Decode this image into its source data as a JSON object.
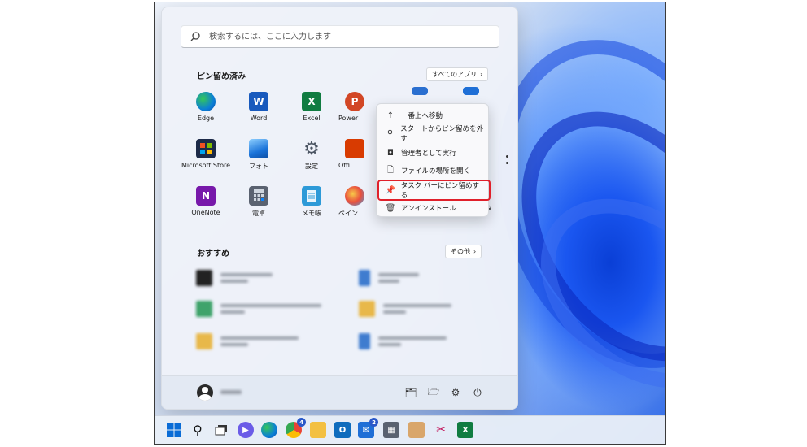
{
  "search": {
    "placeholder": "検索するには、ここに入力します"
  },
  "pinned": {
    "title": "ピン留め済み",
    "all_apps_label": "すべてのアプリ",
    "apps": [
      {
        "label": "Edge"
      },
      {
        "label": "Word"
      },
      {
        "label": "Excel"
      },
      {
        "label": "Power"
      },
      {
        "label": "Microsoft Store"
      },
      {
        "label": "フォト"
      },
      {
        "label": "設定"
      },
      {
        "label": "Offi"
      },
      {
        "label": "ook"
      },
      {
        "label": "OneNote"
      },
      {
        "label": "電卓"
      },
      {
        "label": "メモ帳"
      },
      {
        "label": "ペイン"
      },
      {
        "label": "ィタ"
      }
    ]
  },
  "recommended": {
    "title": "おすすめ",
    "other_label": "その他"
  },
  "context_menu": {
    "items": [
      {
        "label": "一番上へ移動",
        "icon": "arrow-up-icon"
      },
      {
        "label": "スタートからピン留めを外す",
        "icon": "unpin-icon"
      },
      {
        "label": "管理者として実行",
        "icon": "admin-shield-icon"
      },
      {
        "label": "ファイルの場所を開く",
        "icon": "file-location-icon"
      },
      {
        "label": "タスク バーにピン留めする",
        "icon": "pin-icon"
      },
      {
        "label": "アンインストール",
        "icon": "trash-icon"
      }
    ]
  },
  "taskbar": {
    "mail_badge": "2",
    "chrome_badge": "4"
  },
  "colors": {
    "accent": "#0067c0",
    "highlight_border": "#e0202a",
    "wallpaper_blue": "#1a56f0"
  }
}
